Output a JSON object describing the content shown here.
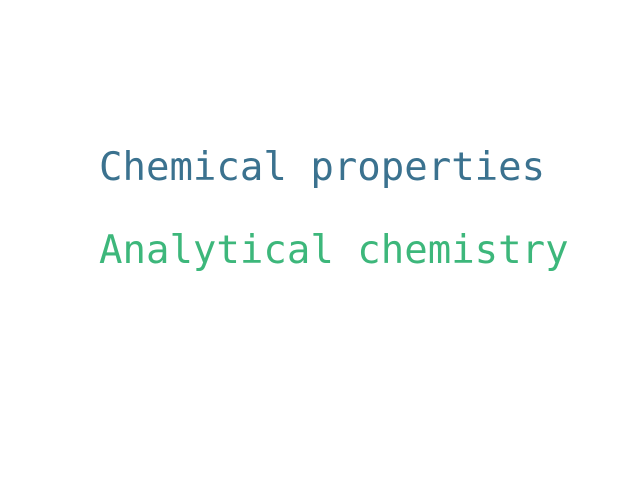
{
  "terms": [
    {
      "text": "Chemical properties",
      "color": "#3b728f"
    },
    {
      "text": "Analytical chemistry",
      "color": "#3db77b"
    }
  ]
}
